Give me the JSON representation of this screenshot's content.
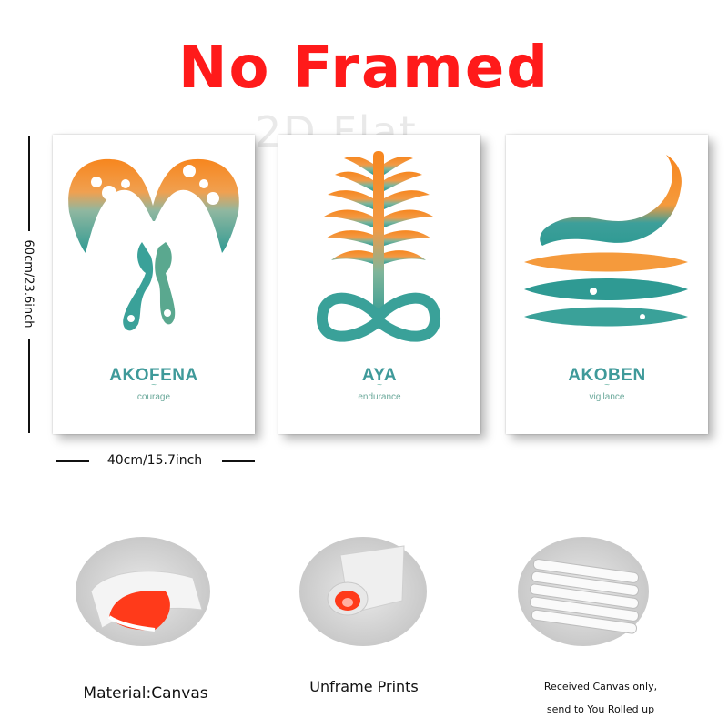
{
  "headline": "No Framed",
  "watermark": "2D Flat",
  "posters": [
    {
      "name": "AKOFENA",
      "meaning": "courage"
    },
    {
      "name": "AYA",
      "meaning": "endurance"
    },
    {
      "name": "AKOBEN",
      "meaning": "vigilance"
    }
  ],
  "dimensions": {
    "height": "60cm/23.6inch",
    "width": "40cm/15.7inch"
  },
  "features": [
    {
      "caption": "Material:Canvas"
    },
    {
      "caption": "Unframe  Prints"
    },
    {
      "caption_line1": "Received Canvas only,",
      "caption_line2": "send to You Rolled up"
    }
  ],
  "colors": {
    "headline": "#ff1a1a",
    "orange": "#f7861e",
    "teal": "#2f9a93",
    "poster_text": "#3f9a9a"
  }
}
